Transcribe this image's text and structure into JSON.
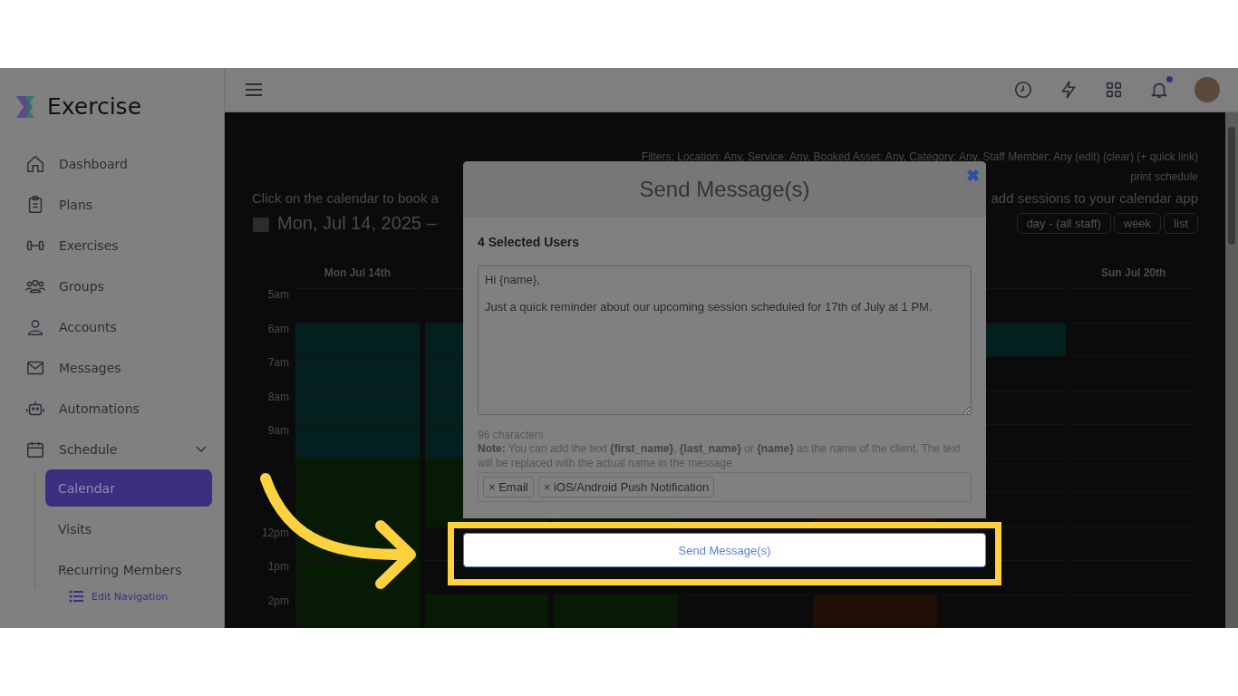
{
  "app": {
    "name": "Exercise"
  },
  "sidebar": {
    "items": [
      {
        "label": "Dashboard"
      },
      {
        "label": "Plans"
      },
      {
        "label": "Exercises"
      },
      {
        "label": "Groups"
      },
      {
        "label": "Accounts"
      },
      {
        "label": "Messages"
      },
      {
        "label": "Automations"
      },
      {
        "label": "Schedule",
        "expanded": true,
        "children": [
          {
            "label": "Calendar",
            "selected": true
          },
          {
            "label": "Visits",
            "selected": false
          },
          {
            "label": "Recurring Members",
            "selected": false
          }
        ]
      }
    ],
    "edit_navigation": "Edit Navigation"
  },
  "topbar": {
    "notification_dot": true
  },
  "calendar": {
    "filters": "Filters: Location: Any, Service: Any, Booked Asset: Any, Category: Any, Staff Member: Any (edit) (clear) (+ quick link)",
    "print": "print schedule",
    "hint": "Click on the calendar to book a",
    "subscribe": "add sessions to your calendar app",
    "range": "Mon, Jul 14, 2025 –",
    "views": [
      "day - (all staff)",
      "week",
      "list"
    ],
    "days": [
      "Mon Jul 14th",
      "Sun Jul 20th"
    ],
    "times": [
      "5am",
      "6am",
      "7am",
      "8am",
      "9am",
      "12pm",
      "1pm",
      "2pm"
    ]
  },
  "modal": {
    "title": "Send Message(s)",
    "close": "✖",
    "selected_users": "4 Selected Users",
    "message": "Hi {name},\n\nJust a quick reminder about our upcoming session scheduled for 17th of July at 1 PM.",
    "char_count": "96 characters",
    "note": "**Note:** You can add the text **{first_name}**, **{last_name}** or **{name}** as the name of the client. The text will be replaced with the actual name in the message.",
    "channels": [
      {
        "label": "Email",
        "remove": "×"
      },
      {
        "label": "iOS/Android Push Notification",
        "remove": "×"
      }
    ],
    "send_button": "Send Message(s)"
  }
}
